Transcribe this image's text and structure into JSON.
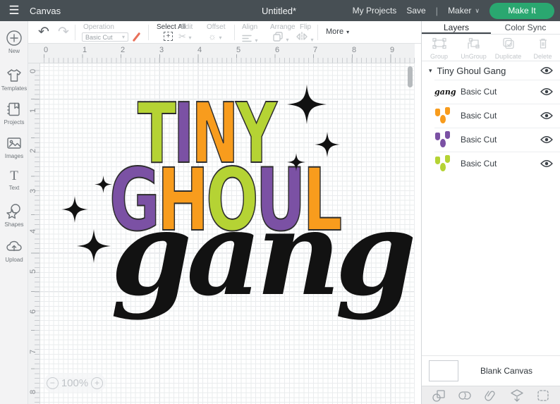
{
  "header": {
    "app_label": "Canvas",
    "doc_title": "Untitled*",
    "my_projects": "My Projects",
    "save": "Save",
    "separator": "|",
    "machine": "Maker",
    "make_it": "Make It"
  },
  "sidebar": {
    "items": [
      {
        "label": "New"
      },
      {
        "label": "Templates"
      },
      {
        "label": "Projects"
      },
      {
        "label": "Images"
      },
      {
        "label": "Text"
      },
      {
        "label": "Shapes"
      },
      {
        "label": "Upload"
      }
    ]
  },
  "toolbar": {
    "operation_label": "Operation",
    "operation_value": "Basic Cut",
    "select_all": "Select All",
    "edit": "Edit",
    "offset": "Offset",
    "align": "Align",
    "arrange": "Arrange",
    "flip": "Flip",
    "more": "More"
  },
  "rulers": {
    "horizontal": [
      "0",
      "1",
      "2",
      "3",
      "4",
      "5",
      "6",
      "7",
      "8",
      "9"
    ],
    "vertical": [
      "0",
      "1",
      "2",
      "3",
      "4",
      "5",
      "6",
      "7",
      "8"
    ]
  },
  "zoom_control": {
    "minus": "−",
    "value": "100%",
    "plus": "+"
  },
  "canvas_design": {
    "word_tiny": {
      "letters": [
        {
          "char": "T",
          "color": "#B5D334"
        },
        {
          "char": "I",
          "color": "#7B51A4"
        },
        {
          "char": "N",
          "color": "#F89C1D"
        },
        {
          "char": "Y",
          "color": "#B5D334"
        }
      ]
    },
    "word_ghoul": {
      "letters": [
        {
          "char": "G",
          "color": "#7B51A4"
        },
        {
          "char": "H",
          "color": "#F89C1D"
        },
        {
          "char": "O",
          "color": "#B5D334"
        },
        {
          "char": "U",
          "color": "#7B51A4"
        },
        {
          "char": "L",
          "color": "#F89C1D"
        }
      ]
    },
    "word_gang": {
      "text": "gang",
      "color": "#121212"
    },
    "sparkle_color": "#121212"
  },
  "layers_panel": {
    "tabs": [
      {
        "label": "Layers"
      },
      {
        "label": "Color Sync"
      }
    ],
    "actions": [
      {
        "label": "Group"
      },
      {
        "label": "UnGroup"
      },
      {
        "label": "Duplicate"
      },
      {
        "label": "Delete"
      }
    ],
    "group_title": "Tiny Ghoul Gang",
    "items": [
      {
        "label": "Basic Cut",
        "color": "#121212",
        "thumb_text": "gang"
      },
      {
        "label": "Basic Cut",
        "color": "#F89C1D"
      },
      {
        "label": "Basic Cut",
        "color": "#7B51A4"
      },
      {
        "label": "Basic Cut",
        "color": "#B5D334"
      }
    ],
    "blank_canvas_label": "Blank Canvas"
  },
  "icons": {
    "hamburger": "☰",
    "chevron_down": "∨",
    "caret_down": "▾",
    "undo": "↶",
    "redo": "↷",
    "scissors": "✂",
    "offset_sun": "☼",
    "plus": "+",
    "text_T": "T"
  },
  "colors": {
    "header_bg": "#474F54",
    "make_it_green": "#2AA770",
    "design_green": "#B5D334",
    "design_purple": "#7B51A4",
    "design_orange": "#F89C1D",
    "design_black": "#121212"
  }
}
